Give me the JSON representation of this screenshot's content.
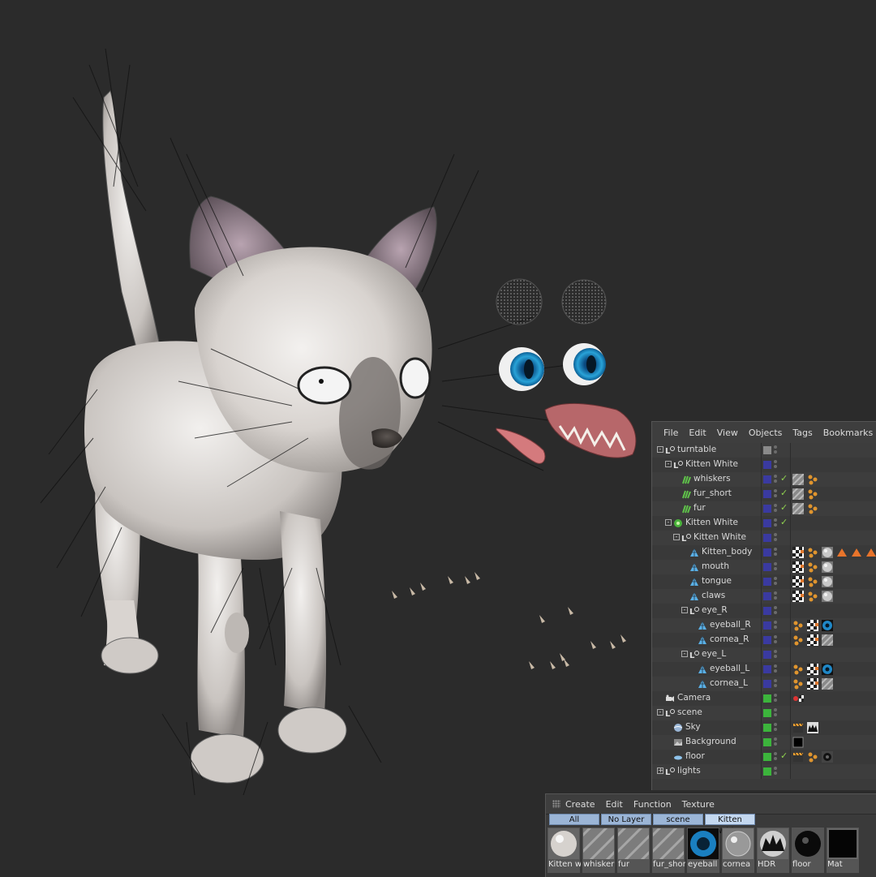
{
  "object_manager": {
    "menu": [
      "File",
      "Edit",
      "View",
      "Objects",
      "Tags",
      "Bookmarks"
    ],
    "rows": [
      {
        "name": "turntable",
        "depth": 0,
        "icon": "null-icon",
        "layer": "#8a8a8a",
        "expand": "-"
      },
      {
        "name": "Kitten White",
        "depth": 1,
        "icon": "null-icon",
        "layer": "#3a3aa0",
        "expand": "-"
      },
      {
        "name": "whiskers",
        "depth": 2,
        "icon": "hair-icon",
        "layer": "#3a3aa0",
        "check": true,
        "tags": [
          "hatch",
          "material-dots"
        ]
      },
      {
        "name": "fur_short",
        "depth": 2,
        "icon": "hair-icon",
        "layer": "#3a3aa0",
        "check": true,
        "tags": [
          "hatch",
          "material-dots"
        ]
      },
      {
        "name": "fur",
        "depth": 2,
        "icon": "hair-icon",
        "layer": "#3a3aa0",
        "check": true,
        "tags": [
          "hatch",
          "material-dots"
        ]
      },
      {
        "name": "Kitten White",
        "depth": 1,
        "icon": "sphere-green-icon",
        "layer": "#3a3aa0",
        "check": true,
        "expand": "-"
      },
      {
        "name": "Kitten White",
        "depth": 2,
        "icon": "null-icon",
        "layer": "#3a3aa0",
        "expand": "-"
      },
      {
        "name": "Kitten_body",
        "depth": 3,
        "icon": "polygon-icon",
        "layer": "#3a3aa0",
        "tags": [
          "checker",
          "material-dots",
          "sphere-gray",
          "triangle-orange",
          "triangle-orange",
          "triangle-orange"
        ]
      },
      {
        "name": "mouth",
        "depth": 3,
        "icon": "polygon-icon",
        "layer": "#3a3aa0",
        "tags": [
          "checker",
          "material-dots",
          "sphere-gray"
        ]
      },
      {
        "name": "tongue",
        "depth": 3,
        "icon": "polygon-icon",
        "layer": "#3a3aa0",
        "tags": [
          "checker",
          "material-dots",
          "sphere-gray"
        ]
      },
      {
        "name": "claws",
        "depth": 3,
        "icon": "polygon-icon",
        "layer": "#3a3aa0",
        "tags": [
          "checker",
          "material-dots",
          "sphere-gray"
        ]
      },
      {
        "name": "eye_R",
        "depth": 3,
        "icon": "null-icon",
        "layer": "#3a3aa0",
        "expand": "-"
      },
      {
        "name": "eyeball_R",
        "depth": 4,
        "icon": "polygon-icon",
        "layer": "#3a3aa0",
        "tags": [
          "material-dots",
          "checker",
          "eye-blue"
        ]
      },
      {
        "name": "cornea_R",
        "depth": 4,
        "icon": "polygon-icon",
        "layer": "#3a3aa0",
        "tags": [
          "material-dots",
          "checker",
          "hatch"
        ]
      },
      {
        "name": "eye_L",
        "depth": 3,
        "icon": "null-icon",
        "layer": "#3a3aa0",
        "expand": "-"
      },
      {
        "name": "eyeball_L",
        "depth": 4,
        "icon": "polygon-icon",
        "layer": "#3a3aa0",
        "tags": [
          "material-dots",
          "checker",
          "eye-blue"
        ]
      },
      {
        "name": "cornea_L",
        "depth": 4,
        "icon": "polygon-icon",
        "layer": "#3a3aa0",
        "tags": [
          "material-dots",
          "checker",
          "hatch"
        ]
      },
      {
        "name": "Camera",
        "depth": 0,
        "icon": "camera-icon",
        "layer": "#3cb43c",
        "tags": [
          "camera-target"
        ]
      },
      {
        "name": "scene",
        "depth": 0,
        "icon": "null-icon",
        "layer": "#3cb43c",
        "expand": "-"
      },
      {
        "name": "Sky",
        "depth": 1,
        "icon": "sky-icon",
        "layer": "#3cb43c",
        "tags": [
          "clapper",
          "hdr-cat"
        ]
      },
      {
        "name": "Background",
        "depth": 1,
        "icon": "background-icon",
        "layer": "#3cb43c",
        "tags": [
          "black-square"
        ]
      },
      {
        "name": "floor",
        "depth": 1,
        "icon": "floor-icon",
        "layer": "#3cb43c",
        "check": true,
        "tags": [
          "clapper",
          "material-dots",
          "floor-dark"
        ]
      },
      {
        "name": "lights",
        "depth": 0,
        "icon": "null-icon",
        "layer": "#3cb43c",
        "expand": "+"
      }
    ]
  },
  "material_manager": {
    "menu": [
      "Create",
      "Edit",
      "Function",
      "Texture"
    ],
    "tabs": [
      "All",
      "No Layer",
      "scene",
      "Kitten White"
    ],
    "active_tab": "Kitten White",
    "materials": [
      {
        "name": "Kitten w",
        "swatch": "sphere-white"
      },
      {
        "name": "whisker",
        "swatch": "hatch"
      },
      {
        "name": "fur",
        "swatch": "hatch"
      },
      {
        "name": "fur_shor",
        "swatch": "hatch"
      },
      {
        "name": "eyeball",
        "swatch": "eye-blue"
      },
      {
        "name": "cornea",
        "swatch": "glass"
      },
      {
        "name": "HDR",
        "swatch": "hdr-cat"
      },
      {
        "name": "floor",
        "swatch": "floor-dark"
      },
      {
        "name": "Mat",
        "swatch": "black"
      }
    ]
  },
  "colors": {
    "viewport_bg": "#2b2b2b",
    "panel_bg": "#3a3a3a",
    "tab_bg": "#9bb5d6",
    "check_green": "#8fd14f",
    "tag_orange": "#e8742b"
  }
}
